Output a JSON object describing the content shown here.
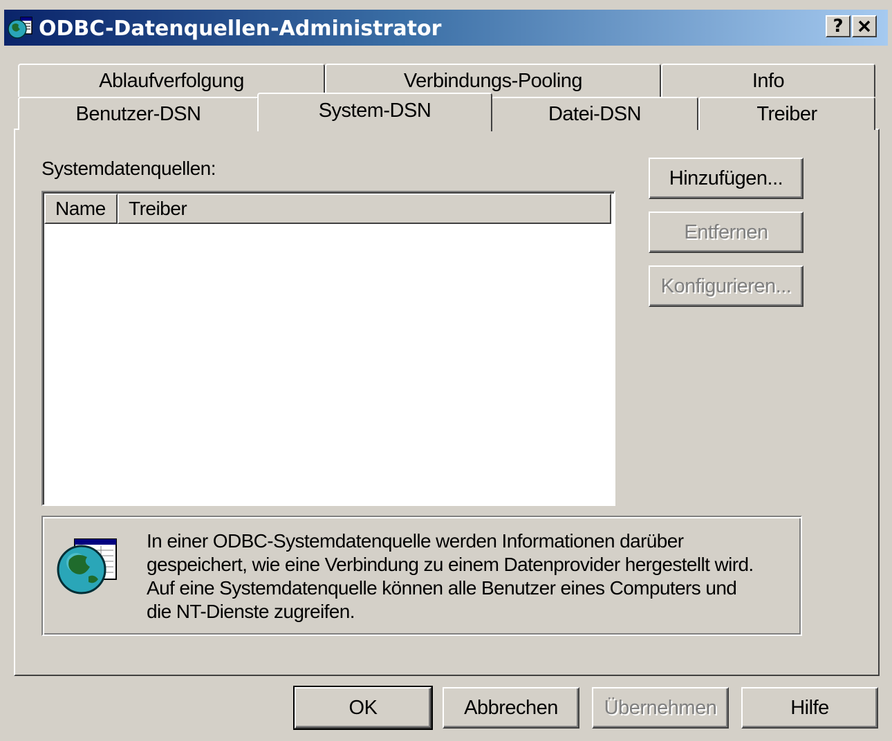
{
  "window": {
    "title": "ODBC-Datenquellen-Administrator",
    "help_button": "?",
    "close_button": "✕"
  },
  "tabs": {
    "row_back": [
      "Ablaufverfolgung",
      "Verbindungs-Pooling",
      "Info"
    ],
    "row_front": [
      "Benutzer-DSN",
      "System-DSN",
      "Datei-DSN",
      "Treiber"
    ],
    "active": "System-DSN"
  },
  "panel": {
    "list_label": "Systemdatenquellen:",
    "columns": [
      "Name",
      "Treiber"
    ],
    "rows": []
  },
  "side_buttons": {
    "add": "Hinzufügen...",
    "remove": "Entfernen",
    "configure": "Konfigurieren..."
  },
  "info": {
    "icon": "globe-datasource-icon",
    "lines": [
      "In einer ODBC-Systemdatenquelle werden Informationen darüber",
      "gespeichert, wie eine Verbindung zu einem Datenprovider hergestellt wird.",
      "Auf eine Systemdatenquelle können alle Benutzer eines Computers und",
      "die NT-Dienste  zugreifen."
    ]
  },
  "bottom_buttons": {
    "ok": "OK",
    "cancel": "Abbrechen",
    "apply": "Übernehmen",
    "help": "Hilfe"
  },
  "colors": {
    "face": "#d4d0c8",
    "title_start": "#0a246a",
    "title_end": "#a6caf0",
    "disabled_text": "#808080"
  }
}
